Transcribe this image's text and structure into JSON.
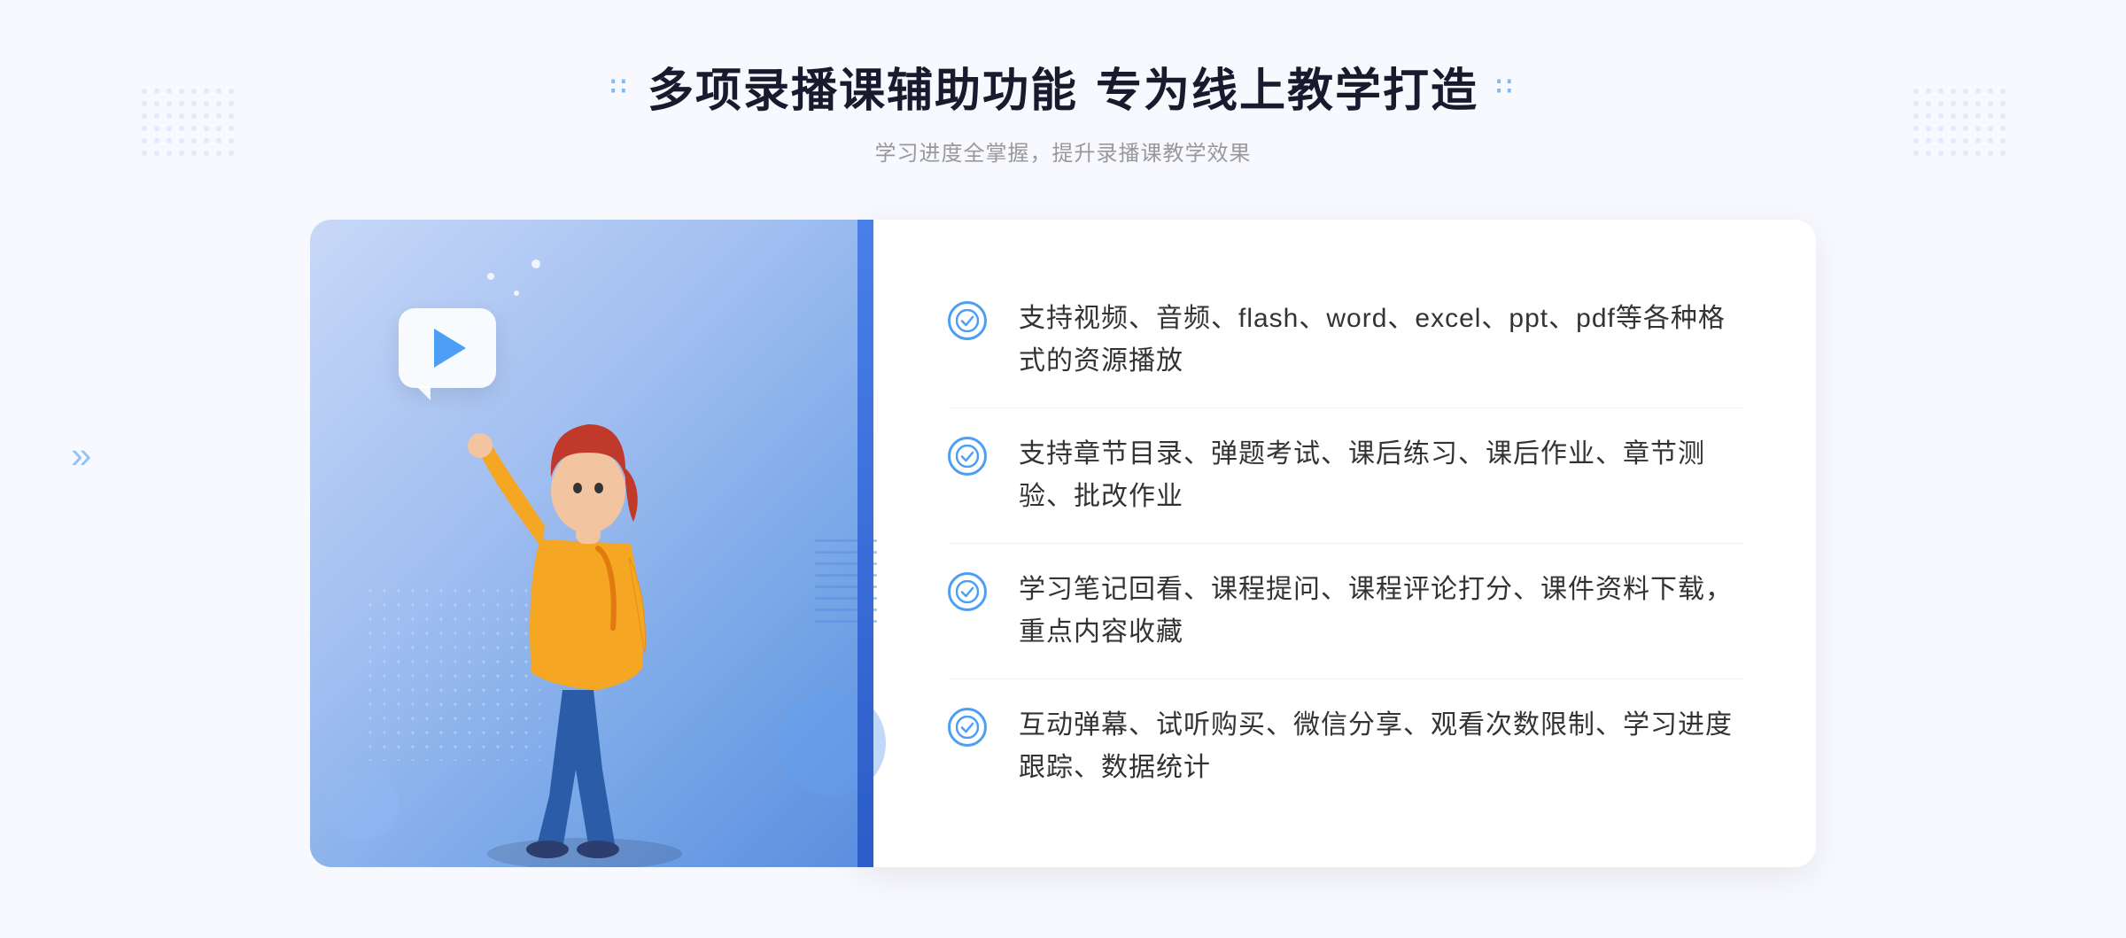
{
  "header": {
    "title": "多项录播课辅助功能 专为线上教学打造",
    "title_left": "多项录播课辅助功能",
    "title_right": "专为线上教学打造",
    "subtitle": "学习进度全掌握，提升录播课教学效果",
    "title_dots_left": "∷",
    "title_dots_right": "∷"
  },
  "features": [
    {
      "id": 1,
      "text": "支持视频、音频、flash、word、excel、ppt、pdf等各种格式的资源播放"
    },
    {
      "id": 2,
      "text": "支持章节目录、弹题考试、课后练习、课后作业、章节测验、批改作业"
    },
    {
      "id": 3,
      "text": "学习笔记回看、课程提问、课程评论打分、课件资料下载，重点内容收藏"
    },
    {
      "id": 4,
      "text": "互动弹幕、试听购买、微信分享、观看次数限制、学习进度跟踪、数据统计"
    }
  ],
  "check_icon_char": "✓",
  "chevrons": "»",
  "decorative": {
    "dots_char": "∷"
  }
}
